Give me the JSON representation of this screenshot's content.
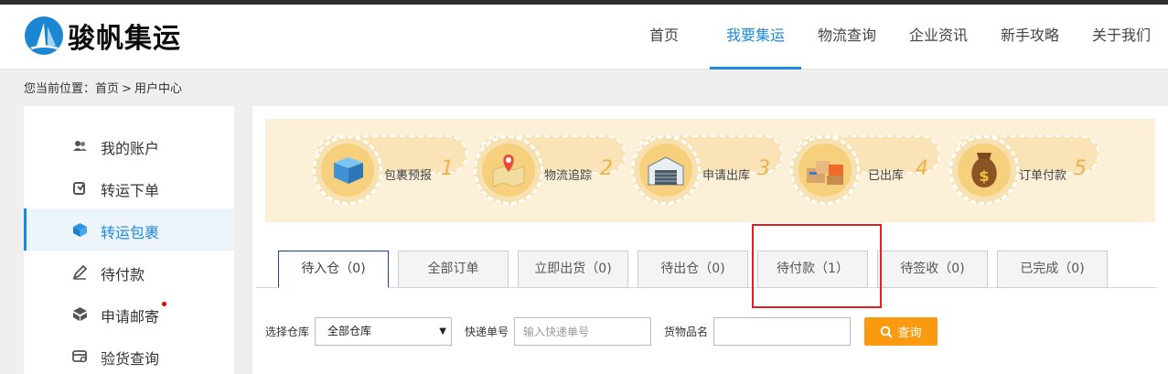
{
  "header": {
    "logo_text": "骏帆集运",
    "nav": [
      {
        "label": "首页"
      },
      {
        "label": "我要集运"
      },
      {
        "label": "物流查询"
      },
      {
        "label": "企业资讯"
      },
      {
        "label": "新手攻略"
      },
      {
        "label": "关于我们"
      }
    ],
    "active_nav": "我要集运",
    "accent_color": "#1d8ad9"
  },
  "breadcrumb": {
    "prefix": "您当前位置：",
    "home": "首页",
    "separator": ">",
    "current": "用户中心"
  },
  "sidebar": {
    "items": [
      {
        "label": "我的账户",
        "icon": "users-icon"
      },
      {
        "label": "转运下单",
        "icon": "order-icon"
      },
      {
        "label": "转运包裹",
        "icon": "package-cube-icon"
      },
      {
        "label": "待付款",
        "icon": "edit-pen-icon"
      },
      {
        "label": "申请邮寄",
        "icon": "box-icon"
      },
      {
        "label": "验货查询",
        "icon": "inspect-icon"
      }
    ],
    "active": "转运包裹",
    "dot_on": "申请邮寄"
  },
  "steps": [
    {
      "label": "包裹预报",
      "num": "1",
      "icon": "package-icon"
    },
    {
      "label": "物流追踪",
      "num": "2",
      "icon": "map-pin-icon"
    },
    {
      "label": "申请出库",
      "num": "3",
      "icon": "warehouse-icon"
    },
    {
      "label": "已出库",
      "num": "4",
      "icon": "boxes-icon"
    },
    {
      "label": "订单付款",
      "num": "5",
      "icon": "money-bag-icon"
    }
  ],
  "tabs": [
    {
      "label": "待入仓（0)"
    },
    {
      "label": "全部订单"
    },
    {
      "label": "立即出货（0)"
    },
    {
      "label": "待出仓（0)"
    },
    {
      "label": "待付款（1）"
    },
    {
      "label": "待签收（0)"
    },
    {
      "label": "已完成（0)"
    }
  ],
  "active_tab": "待入仓（0)",
  "filters": {
    "warehouse_label": "选择仓库",
    "warehouse_value": "全部仓库",
    "tracking_label": "快递单号",
    "tracking_placeholder": "输入快递单号",
    "goods_label": "货物品名",
    "goods_value": "",
    "search_label": "查询"
  }
}
